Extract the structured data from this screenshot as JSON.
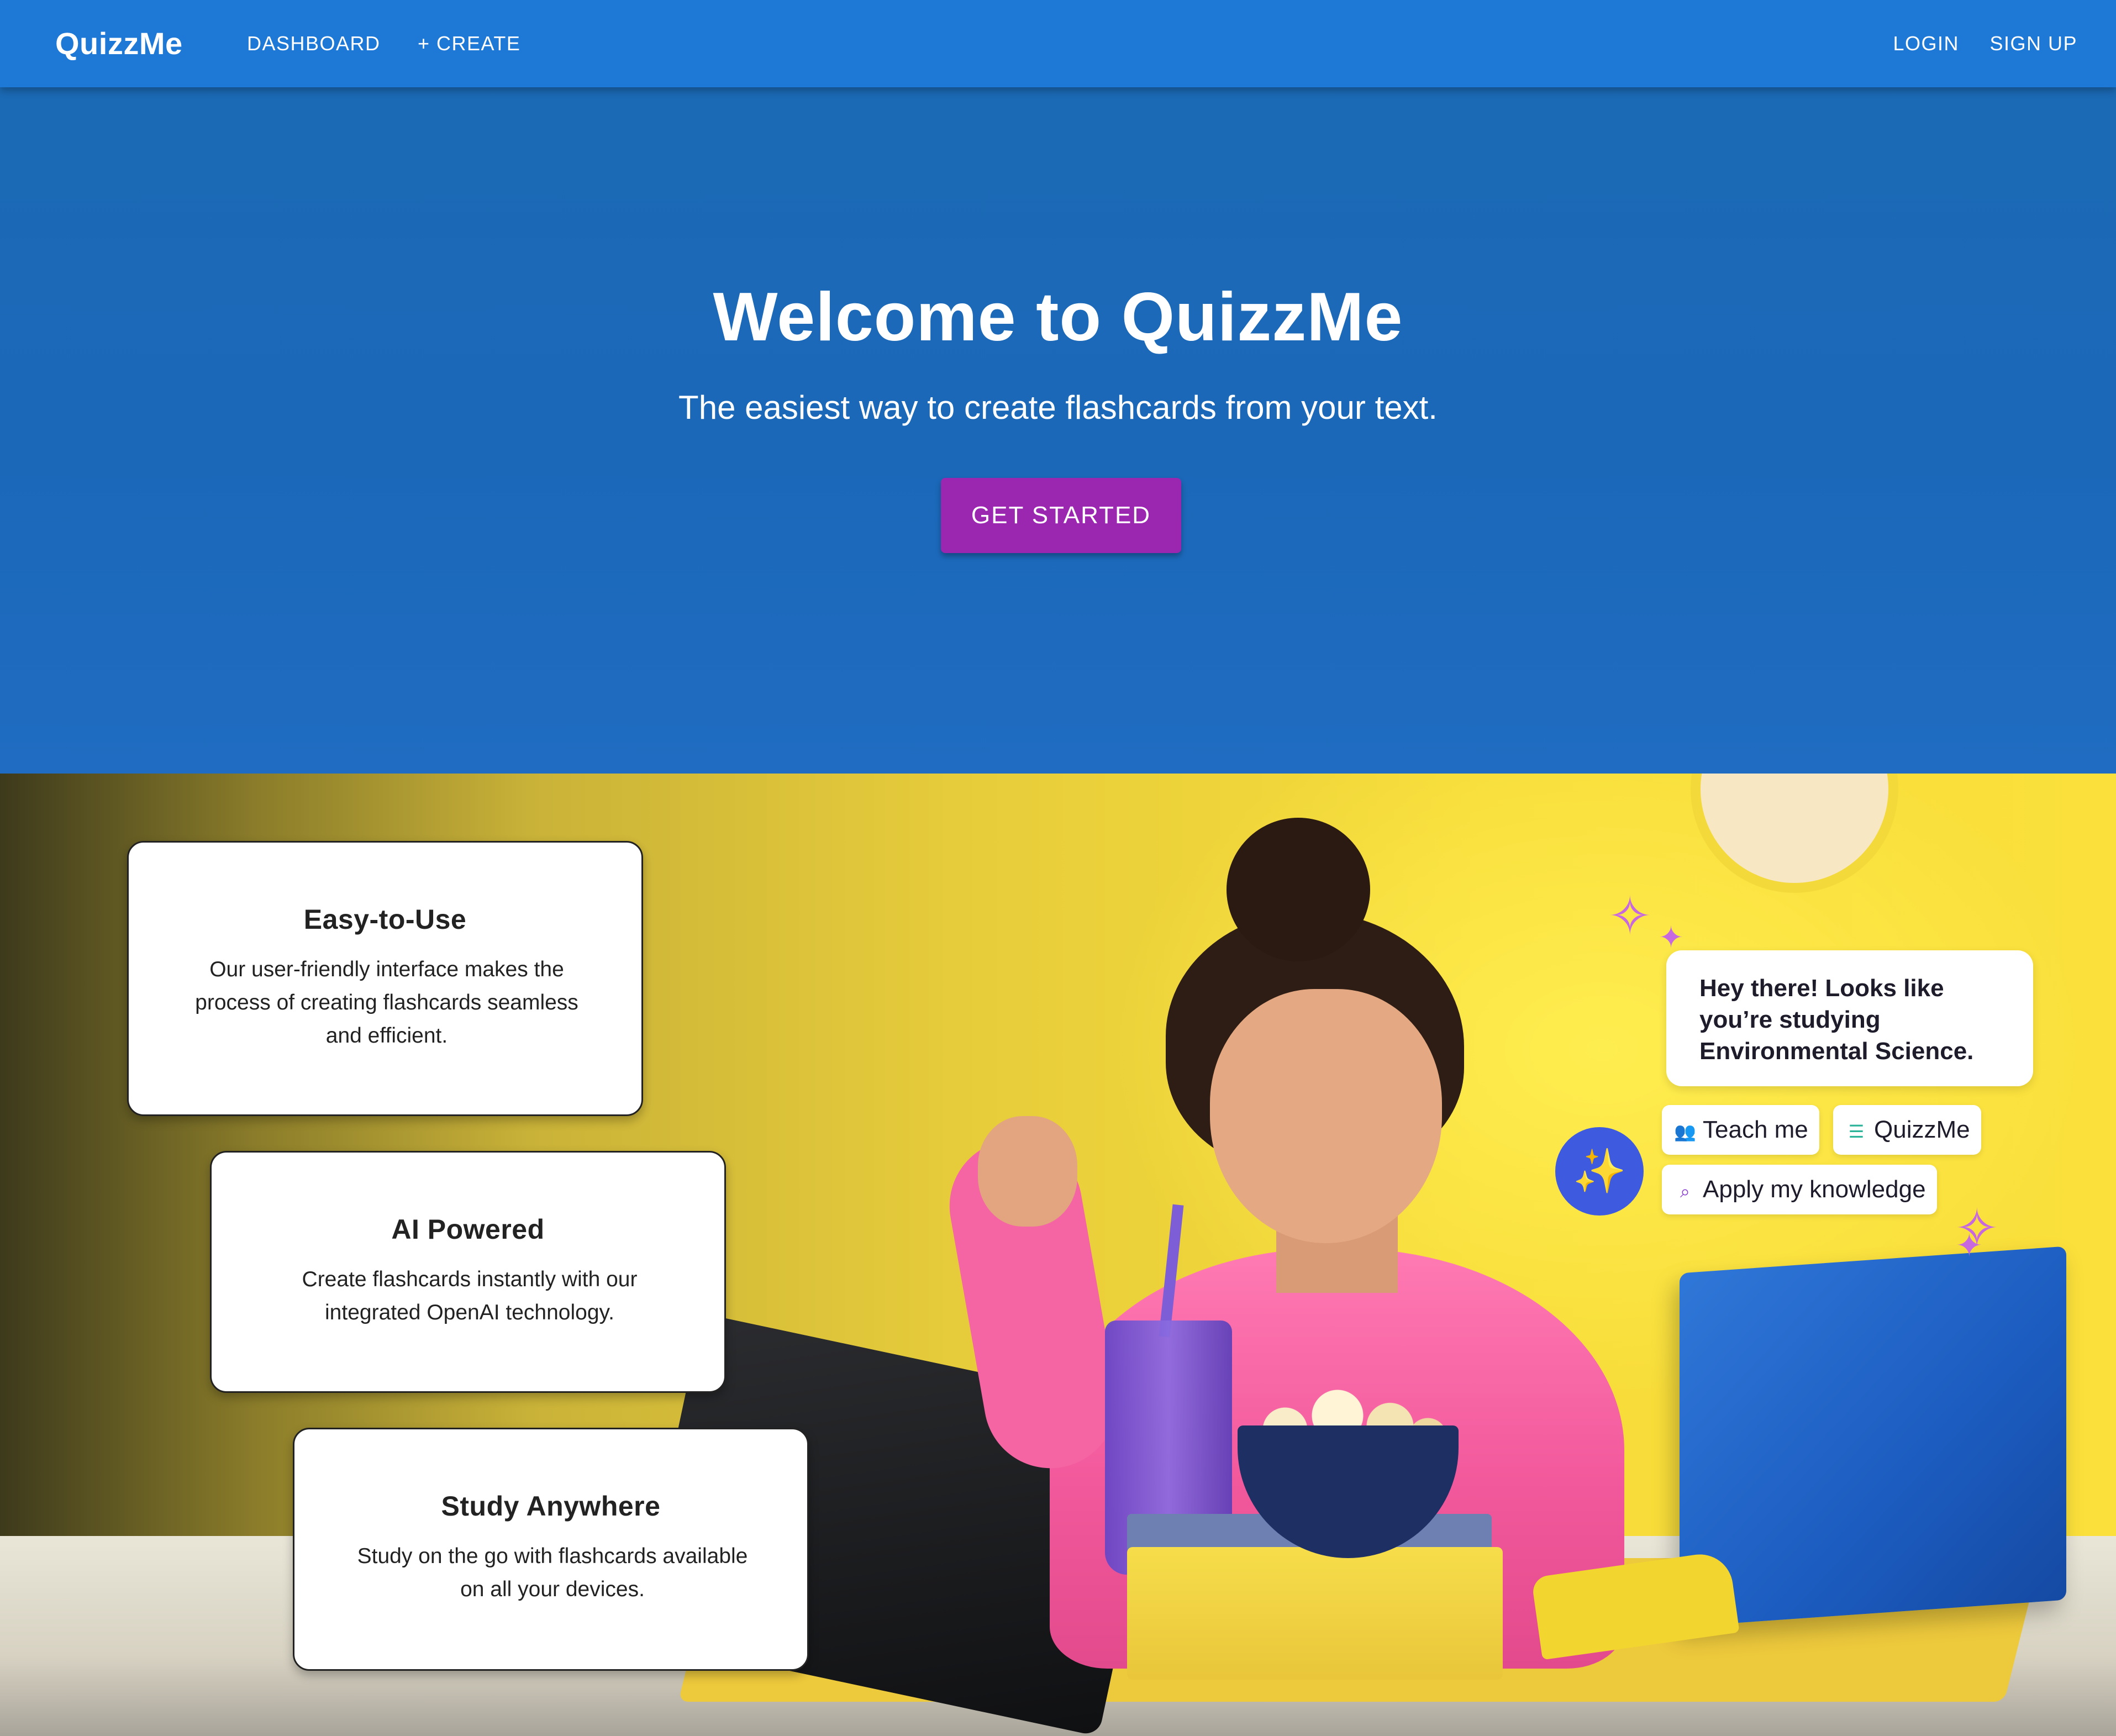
{
  "appbar": {
    "brand": "QuizzMe",
    "nav_left": [
      {
        "label": "DASHBOARD"
      },
      {
        "label": "+ CREATE"
      }
    ],
    "nav_right": [
      {
        "label": "LOGIN"
      },
      {
        "label": "SIGN UP"
      }
    ]
  },
  "hero": {
    "title": "Welcome to QuizzMe",
    "subtitle": "The easiest way to create flashcards from your text.",
    "cta_label": "GET STARTED"
  },
  "features": [
    {
      "title": "Easy-to-Use",
      "description": "Our user-friendly interface makes the process of creating flashcards seamless and efficient."
    },
    {
      "title": "AI Powered",
      "description": "Create flashcards instantly with our integrated OpenAI technology."
    },
    {
      "title": "Study Anywhere",
      "description": "Study on the go with flashcards available on all your devices."
    }
  ],
  "illustration": {
    "chat_message": "Hey there! Looks like you’re studying Environmental Science.",
    "chips": [
      {
        "label": "Teach me",
        "icon": "people-icon"
      },
      {
        "label": "QuizzMe",
        "icon": "list-icon"
      },
      {
        "label": "Apply my knowledge",
        "icon": "magnifier-icon"
      }
    ],
    "magic_icon": "magic-wand-icon"
  },
  "colors": {
    "appbar": "#1e78d6",
    "hero": "#1b6ab5",
    "cta": "#9b27b0",
    "card_background": "#ffffff",
    "magic_circle": "#3e5be0",
    "sparkle": "#c768e0"
  }
}
